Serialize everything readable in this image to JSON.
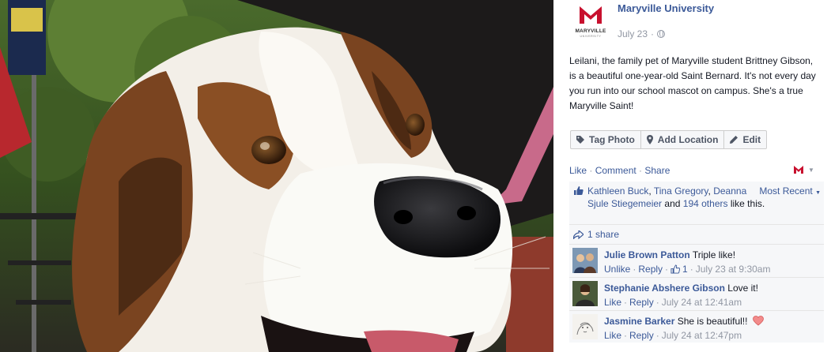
{
  "post": {
    "page_name": "Maryville University",
    "logo_wordmark": "MARYVILLE",
    "logo_sub": "UNIVERSITY",
    "date": "July 23",
    "separator": "·",
    "caption": "Leilani, the family pet of Maryville student Brittney Gibson, is a beautiful one-year-old Saint Bernard. It's not every day you run into our school mascot on campus. She's a true Maryville Saint!"
  },
  "actions": {
    "tag_photo": "Tag Photo",
    "add_location": "Add Location",
    "edit": "Edit"
  },
  "ufi": {
    "like": "Like",
    "comment": "Comment",
    "share": "Share",
    "sep": " · ",
    "likers_1": "Kathleen Buck",
    "likers_2": "Tina Gregory",
    "likers_3": "Deanna Sjule Stiegemeier",
    "likers_and": "and",
    "likers_others": "194 others",
    "likers_tail": "like this.",
    "most_recent": "Most Recent",
    "shares": "1 share"
  },
  "comments": [
    {
      "author": "Julie Brown Patton",
      "text": "Triple like!",
      "action": "Unlike",
      "reply": "Reply",
      "likes": "1",
      "time": "July 23 at 9:30am"
    },
    {
      "author": "Stephanie Abshere Gibson",
      "text": "Love it!",
      "action": "Like",
      "reply": "Reply",
      "time": "July 24 at 12:41am"
    },
    {
      "author": "Jasmine Barker",
      "text": "She is beautiful!!",
      "action": "Like",
      "reply": "Reply",
      "time": "July 24 at 12:47pm"
    }
  ],
  "colors": {
    "link": "#3b5998",
    "meta": "#9197a3",
    "brand_red": "#c8102e"
  },
  "icons": [
    "globe-icon",
    "tag-icon",
    "location-pin-icon",
    "pencil-icon",
    "thumbs-up-icon",
    "share-arrow-icon",
    "heart-icon",
    "chevron-down-icon"
  ]
}
